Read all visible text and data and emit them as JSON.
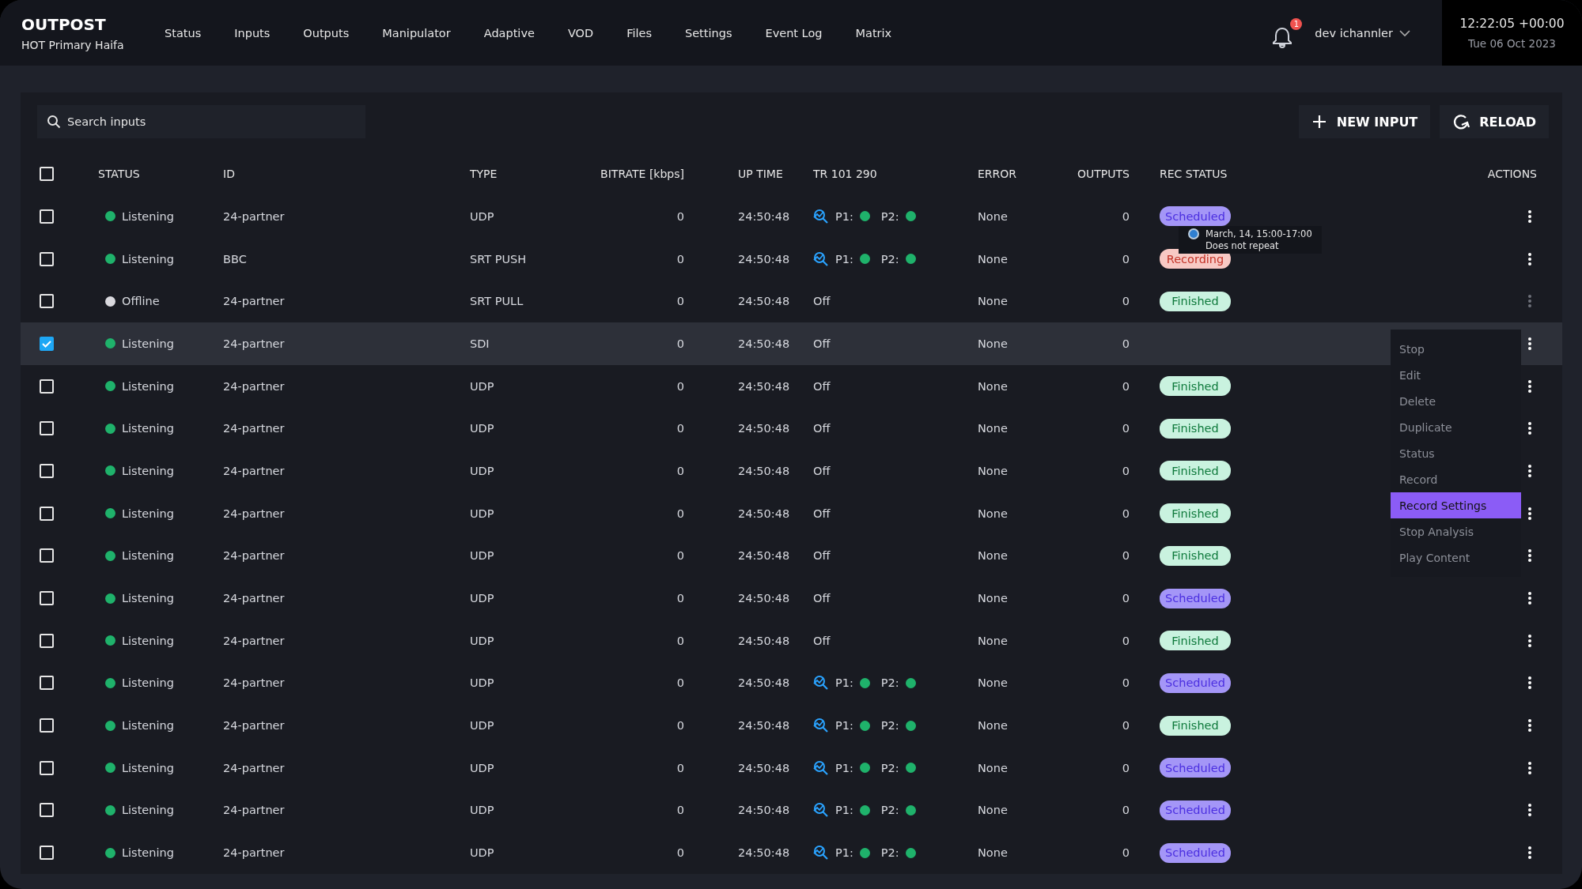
{
  "brand": {
    "title": "OUTPOST",
    "subtitle": "HOT Primary Haifa"
  },
  "nav": [
    "Status",
    "Inputs",
    "Outputs",
    "Manipulator",
    "Adaptive",
    "VOD",
    "Files",
    "Settings",
    "Event Log",
    "Matrix"
  ],
  "notifications": {
    "count": "1"
  },
  "user": "dev ichannler",
  "clock": {
    "time": "12:22:05 +00:00",
    "date": "Tue 06 Oct 2023"
  },
  "search": {
    "placeholder": "Search inputs"
  },
  "buttons": [
    {
      "kind": "add",
      "label": "NEW INPUT"
    },
    {
      "kind": "reload",
      "label": "RELOAD"
    }
  ],
  "table": {
    "select_all": false,
    "columns": [
      "STATUS",
      "ID",
      "TYPE",
      "BITRATE [kbps]",
      "UP TIME",
      "TR 101 290",
      "ERROR",
      "OUTPUTS",
      "REC STATUS",
      "ACTIONS"
    ],
    "rows": [
      {
        "selected": false,
        "color": "#1fb26b",
        "status": "Listening",
        "id": "24-partner",
        "type": "UDP",
        "bitrate": "0",
        "uptime": "24:50:48",
        "tr": {
          "kind": "analysis",
          "p1": "P1:",
          "p2": "P2:"
        },
        "error": "None",
        "outputs": "0",
        "rec": {
          "kind": "scheduled",
          "label": "Scheduled"
        },
        "actions_disabled": false
      },
      {
        "selected": false,
        "color": "#1fb26b",
        "status": "Listening",
        "id": "BBC",
        "type": "SRT PUSH",
        "bitrate": "0",
        "uptime": "24:50:48",
        "tr": {
          "kind": "analysis",
          "p1": "P1:",
          "p2": "P2:"
        },
        "error": "None",
        "outputs": "0",
        "rec": {
          "kind": "recording",
          "label": "Recording"
        },
        "actions_disabled": false
      },
      {
        "selected": false,
        "color": "#d9d9de",
        "status": "Offline",
        "id": "24-partner",
        "type": "SRT PULL",
        "bitrate": "0",
        "uptime": "24:50:48",
        "tr": {
          "kind": "off",
          "label": "Off"
        },
        "error": "None",
        "outputs": "0",
        "rec": {
          "kind": "finished",
          "label": "Finished"
        },
        "actions_disabled": true
      },
      {
        "selected": true,
        "color": "#1fb26b",
        "status": "Listening",
        "id": "24-partner",
        "type": "SDI",
        "bitrate": "0",
        "uptime": "24:50:48",
        "tr": {
          "kind": "off",
          "label": "Off"
        },
        "error": "None",
        "outputs": "0",
        "actions_disabled": false
      },
      {
        "selected": false,
        "color": "#1fb26b",
        "status": "Listening",
        "id": "24-partner",
        "type": "UDP",
        "bitrate": "0",
        "uptime": "24:50:48",
        "tr": {
          "kind": "off",
          "label": "Off"
        },
        "error": "None",
        "outputs": "0",
        "rec": {
          "kind": "finished",
          "label": "Finished"
        },
        "actions_disabled": false
      },
      {
        "selected": false,
        "color": "#1fb26b",
        "status": "Listening",
        "id": "24-partner",
        "type": "UDP",
        "bitrate": "0",
        "uptime": "24:50:48",
        "tr": {
          "kind": "off",
          "label": "Off"
        },
        "error": "None",
        "outputs": "0",
        "rec": {
          "kind": "finished",
          "label": "Finished"
        },
        "actions_disabled": false
      },
      {
        "selected": false,
        "color": "#1fb26b",
        "status": "Listening",
        "id": "24-partner",
        "type": "UDP",
        "bitrate": "0",
        "uptime": "24:50:48",
        "tr": {
          "kind": "off",
          "label": "Off"
        },
        "error": "None",
        "outputs": "0",
        "rec": {
          "kind": "finished",
          "label": "Finished"
        },
        "actions_disabled": false
      },
      {
        "selected": false,
        "color": "#1fb26b",
        "status": "Listening",
        "id": "24-partner",
        "type": "UDP",
        "bitrate": "0",
        "uptime": "24:50:48",
        "tr": {
          "kind": "off",
          "label": "Off"
        },
        "error": "None",
        "outputs": "0",
        "rec": {
          "kind": "finished",
          "label": "Finished"
        },
        "actions_disabled": false
      },
      {
        "selected": false,
        "color": "#1fb26b",
        "status": "Listening",
        "id": "24-partner",
        "type": "UDP",
        "bitrate": "0",
        "uptime": "24:50:48",
        "tr": {
          "kind": "off",
          "label": "Off"
        },
        "error": "None",
        "outputs": "0",
        "rec": {
          "kind": "finished",
          "label": "Finished"
        },
        "actions_disabled": false
      },
      {
        "selected": false,
        "color": "#1fb26b",
        "status": "Listening",
        "id": "24-partner",
        "type": "UDP",
        "bitrate": "0",
        "uptime": "24:50:48",
        "tr": {
          "kind": "off",
          "label": "Off"
        },
        "error": "None",
        "outputs": "0",
        "rec": {
          "kind": "scheduled",
          "label": "Scheduled"
        },
        "actions_disabled": false
      },
      {
        "selected": false,
        "color": "#1fb26b",
        "status": "Listening",
        "id": "24-partner",
        "type": "UDP",
        "bitrate": "0",
        "uptime": "24:50:48",
        "tr": {
          "kind": "off",
          "label": "Off"
        },
        "error": "None",
        "outputs": "0",
        "rec": {
          "kind": "finished",
          "label": "Finished"
        },
        "actions_disabled": false
      },
      {
        "selected": false,
        "color": "#1fb26b",
        "status": "Listening",
        "id": "24-partner",
        "type": "UDP",
        "bitrate": "0",
        "uptime": "24:50:48",
        "tr": {
          "kind": "analysis",
          "p1": "P1:",
          "p2": "P2:"
        },
        "error": "None",
        "outputs": "0",
        "rec": {
          "kind": "scheduled",
          "label": "Scheduled"
        },
        "actions_disabled": false
      },
      {
        "selected": false,
        "color": "#1fb26b",
        "status": "Listening",
        "id": "24-partner",
        "type": "UDP",
        "bitrate": "0",
        "uptime": "24:50:48",
        "tr": {
          "kind": "analysis",
          "p1": "P1:",
          "p2": "P2:"
        },
        "error": "None",
        "outputs": "0",
        "rec": {
          "kind": "finished",
          "label": "Finished"
        },
        "actions_disabled": false
      },
      {
        "selected": false,
        "color": "#1fb26b",
        "status": "Listening",
        "id": "24-partner",
        "type": "UDP",
        "bitrate": "0",
        "uptime": "24:50:48",
        "tr": {
          "kind": "analysis",
          "p1": "P1:",
          "p2": "P2:"
        },
        "error": "None",
        "outputs": "0",
        "rec": {
          "kind": "scheduled",
          "label": "Scheduled"
        },
        "actions_disabled": false
      },
      {
        "selected": false,
        "color": "#1fb26b",
        "status": "Listening",
        "id": "24-partner",
        "type": "UDP",
        "bitrate": "0",
        "uptime": "24:50:48",
        "tr": {
          "kind": "analysis",
          "p1": "P1:",
          "p2": "P2:"
        },
        "error": "None",
        "outputs": "0",
        "rec": {
          "kind": "scheduled",
          "label": "Scheduled"
        },
        "actions_disabled": false
      },
      {
        "selected": false,
        "color": "#1fb26b",
        "status": "Listening",
        "id": "24-partner",
        "type": "UDP",
        "bitrate": "0",
        "uptime": "24:50:48",
        "tr": {
          "kind": "analysis",
          "p1": "P1:",
          "p2": "P2:"
        },
        "error": "None",
        "outputs": "0",
        "rec": {
          "kind": "scheduled",
          "label": "Scheduled"
        },
        "actions_disabled": false
      }
    ]
  },
  "tooltip": {
    "line1": "March, 14, 15:00-17:00",
    "line2": "Does not repeat"
  },
  "context_menu": [
    {
      "label": "Stop",
      "selected": false
    },
    {
      "label": "Edit",
      "selected": false
    },
    {
      "label": "Delete",
      "selected": false
    },
    {
      "label": "Duplicate",
      "selected": false
    },
    {
      "label": "Status",
      "selected": false
    },
    {
      "label": "Record",
      "selected": false
    },
    {
      "label": "Record Settings",
      "selected": true
    },
    {
      "label": "Stop Analysis",
      "selected": false
    },
    {
      "label": "Play Content",
      "selected": false
    }
  ]
}
